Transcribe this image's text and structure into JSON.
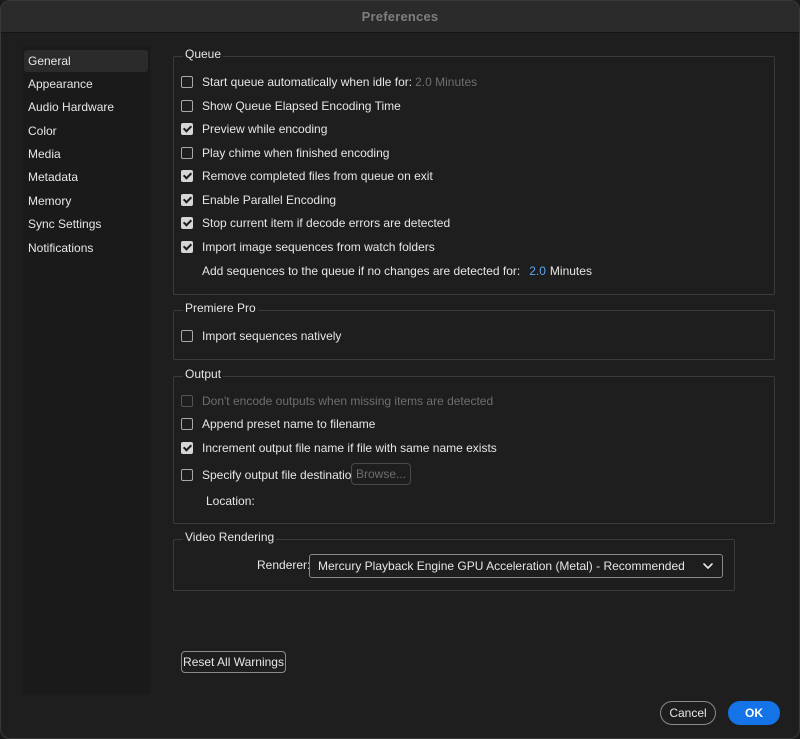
{
  "window": {
    "title": "Preferences"
  },
  "sidebar": {
    "items": [
      {
        "label": "General",
        "selected": true
      },
      {
        "label": "Appearance"
      },
      {
        "label": "Audio Hardware"
      },
      {
        "label": "Color"
      },
      {
        "label": "Media"
      },
      {
        "label": "Metadata"
      },
      {
        "label": "Memory"
      },
      {
        "label": "Sync Settings"
      },
      {
        "label": "Notifications"
      }
    ]
  },
  "queue": {
    "title": "Queue",
    "items": [
      {
        "label": "Start queue automatically when idle for:",
        "checked": false,
        "suffix": "2.0 Minutes"
      },
      {
        "label": "Show Queue Elapsed Encoding Time",
        "checked": false
      },
      {
        "label": "Preview while encoding",
        "checked": true
      },
      {
        "label": "Play chime when finished encoding",
        "checked": false
      },
      {
        "label": "Remove completed files from queue on exit",
        "checked": true
      },
      {
        "label": "Enable Parallel Encoding",
        "checked": true
      },
      {
        "label": "Stop current item if decode errors are detected",
        "checked": true
      },
      {
        "label": "Import image sequences from watch folders",
        "checked": true
      }
    ],
    "add_sequences": {
      "label": "Add sequences to the queue if no changes are detected for:",
      "value": "2.0",
      "unit": "Minutes"
    }
  },
  "premiere": {
    "title": "Premiere Pro",
    "items": [
      {
        "label": "Import sequences natively",
        "checked": false
      }
    ]
  },
  "output": {
    "title": "Output",
    "items": [
      {
        "label": "Don't encode outputs when missing items are detected",
        "checked": false,
        "disabled": true
      },
      {
        "label": "Append preset name to filename",
        "checked": false
      },
      {
        "label": "Increment output file name if file with same name exists",
        "checked": true
      },
      {
        "label": "Specify output file destination:",
        "checked": false
      }
    ],
    "browse_label": "Browse...",
    "location_label": "Location:"
  },
  "video_rendering": {
    "title": "Video Rendering",
    "renderer_label": "Renderer:",
    "renderer_value": "Mercury Playback Engine GPU Acceleration (Metal) - Recommended"
  },
  "footer": {
    "reset_label": "Reset All Warnings",
    "cancel_label": "Cancel",
    "ok_label": "OK"
  },
  "colors": {
    "accent": "#1473e6",
    "value_link": "#5aa7f2",
    "background": "#1e1e1e"
  }
}
